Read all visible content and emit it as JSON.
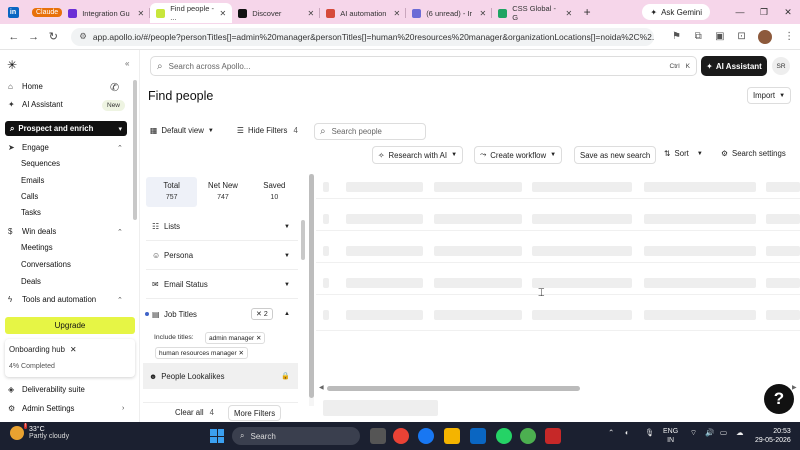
{
  "browser": {
    "group_label": "Claude",
    "tabs": [
      {
        "title": "Integration Gu",
        "color": "#6b2fd6"
      },
      {
        "title": "Find people - ...",
        "color": "#c8e63c"
      },
      {
        "title": "Discover",
        "color": "#111111"
      },
      {
        "title": "AI automation",
        "color": "#d64a3a"
      },
      {
        "title": "(6 unread) - Ir",
        "color": "#6b6bd6"
      },
      {
        "title": "CSS Global - G",
        "color": "#1fa463"
      }
    ],
    "ask_gemini": "Ask Gemini",
    "url": "app.apollo.io/#/people?personTitles[]=admin%20manager&personTitles[]=human%20resources%20manager&organizationLocations[]=noida%2C%2..."
  },
  "nav": {
    "home": "Home",
    "ai_assistant": "AI Assistant",
    "new_badge": "New",
    "prospect": "Prospect and enrich",
    "engage": "Engage",
    "engage_items": [
      "Sequences",
      "Emails",
      "Calls",
      "Tasks"
    ],
    "win_deals": "Win deals",
    "win_items": [
      "Meetings",
      "Conversations",
      "Deals"
    ],
    "tools": "Tools and automation",
    "upgrade": "Upgrade",
    "onboarding": "Onboarding hub",
    "completed": "4% Completed",
    "deliverability": "Deliverability suite",
    "admin": "Admin Settings"
  },
  "header": {
    "search_placeholder": "Search across Apollo...",
    "shortcut_ctrl": "Ctrl",
    "shortcut_k": "K",
    "ai_assistant": "AI Assistant",
    "avatar": "SR",
    "title": "Find people",
    "import": "Import"
  },
  "toolbar": {
    "default_view": "Default view",
    "hide_filters": "Hide Filters",
    "filter_count": "4",
    "search_people": "Search people",
    "research_ai": "Research with AI",
    "create_workflow": "Create workflow",
    "save_search": "Save as new search",
    "sort": "Sort",
    "search_settings": "Search settings"
  },
  "filters": {
    "stats": [
      {
        "label": "Total",
        "value": "757"
      },
      {
        "label": "Net New",
        "value": "747"
      },
      {
        "label": "Saved",
        "value": "10"
      }
    ],
    "lists": "Lists",
    "persona": "Persona",
    "email_status": "Email Status",
    "job_titles": "Job Titles",
    "job_titles_count": "2",
    "include_titles": "Include titles:",
    "titles": [
      "admin manager",
      "human resources manager"
    ],
    "people_lookalikes": "People Lookalikes",
    "clear_all": "Clear all",
    "clear_count": "4",
    "more_filters": "More Filters"
  },
  "taskbar": {
    "temp": "33°C",
    "weather": "Partly cloudy",
    "search": "Search",
    "lang1": "ENG",
    "lang2": "IN",
    "time": "20:53",
    "date": "29-05-2026"
  }
}
